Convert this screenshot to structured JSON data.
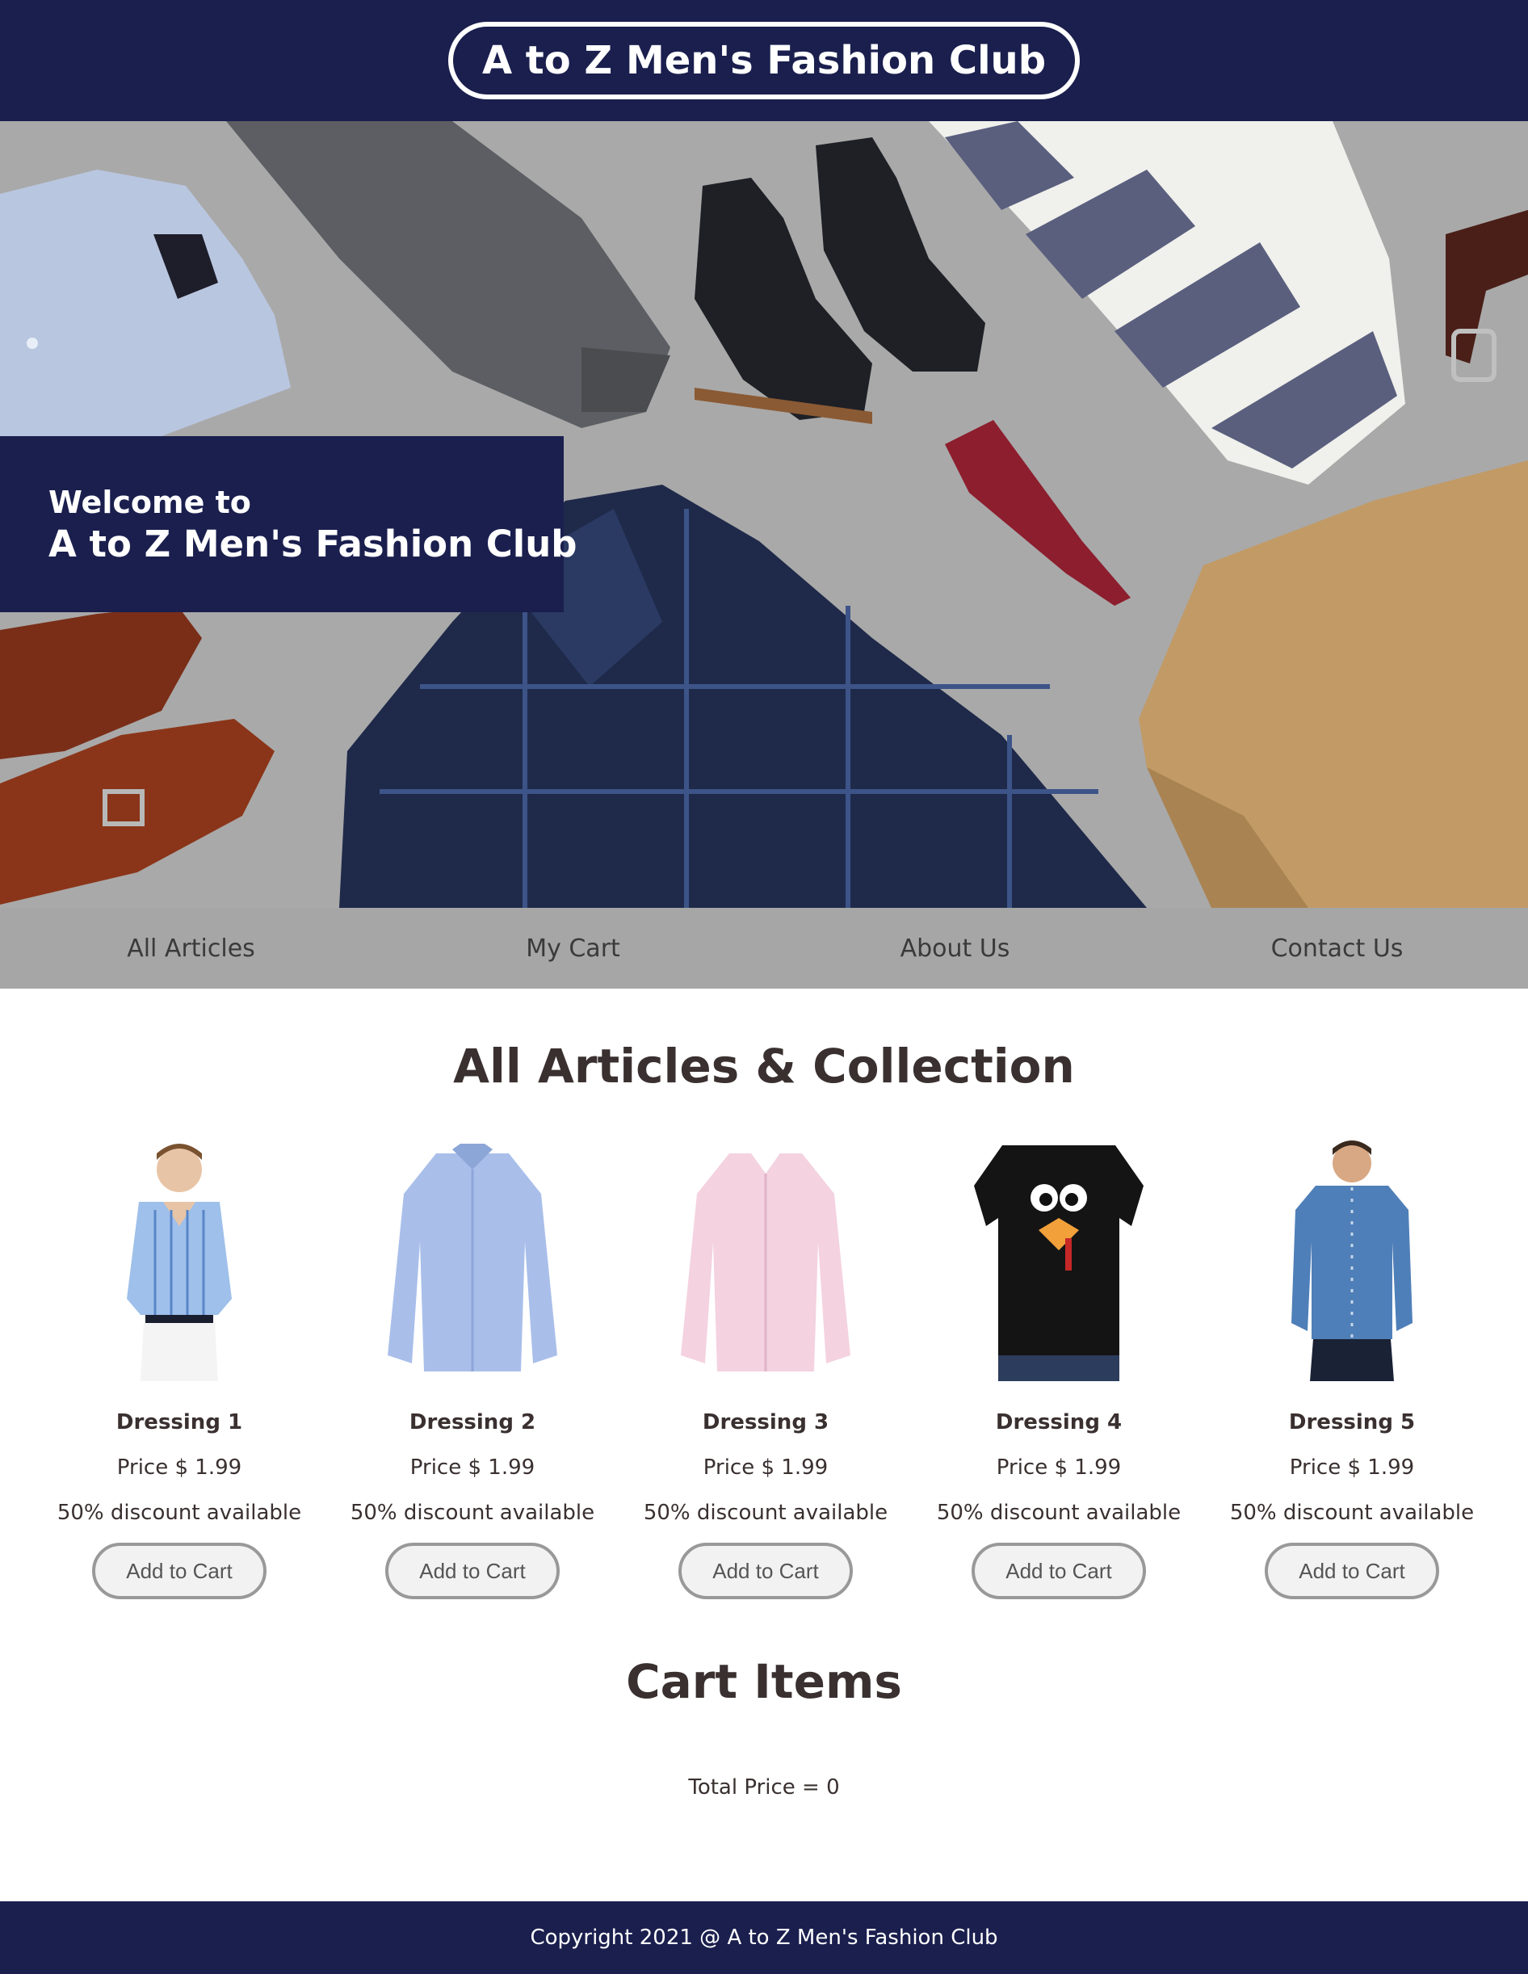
{
  "header": {
    "title": "A to Z Men's Fashion Club"
  },
  "hero": {
    "welcome_line1": "Welcome to",
    "welcome_line2": "A to Z Men's Fashion Club"
  },
  "nav": {
    "items": [
      {
        "label": "All Articles"
      },
      {
        "label": "My Cart"
      },
      {
        "label": "About Us"
      },
      {
        "label": "Contact Us"
      }
    ]
  },
  "articles": {
    "title": "All Articles & Collection",
    "items": [
      {
        "name": "Dressing 1",
        "price": "Price $ 1.99",
        "discount": "50% discount available",
        "button": "Add to Cart",
        "image": "man-in-striped-blue-shirt"
      },
      {
        "name": "Dressing 2",
        "price": "Price $ 1.99",
        "discount": "50% discount available",
        "button": "Add to Cart",
        "image": "light-blue-shirt"
      },
      {
        "name": "Dressing 3",
        "price": "Price $ 1.99",
        "discount": "50% discount available",
        "button": "Add to Cart",
        "image": "pink-shirt"
      },
      {
        "name": "Dressing 4",
        "price": "Price $ 1.99",
        "discount": "50% discount available",
        "button": "Add to Cart",
        "image": "black-turkey-face-tshirt"
      },
      {
        "name": "Dressing 5",
        "price": "Price $ 1.99",
        "discount": "50% discount available",
        "button": "Add to Cart",
        "image": "man-in-denim-shirt"
      }
    ]
  },
  "cart": {
    "title": "Cart Items",
    "total": "Total Price = 0"
  },
  "footer": {
    "text": "Copyright 2021 @ A to Z Men's Fashion Club"
  },
  "colors": {
    "brand_navy": "#1a1f4e",
    "nav_gray": "#a6a6a6",
    "hero_bg": "#a8a8a8",
    "text": "#3a3030"
  }
}
